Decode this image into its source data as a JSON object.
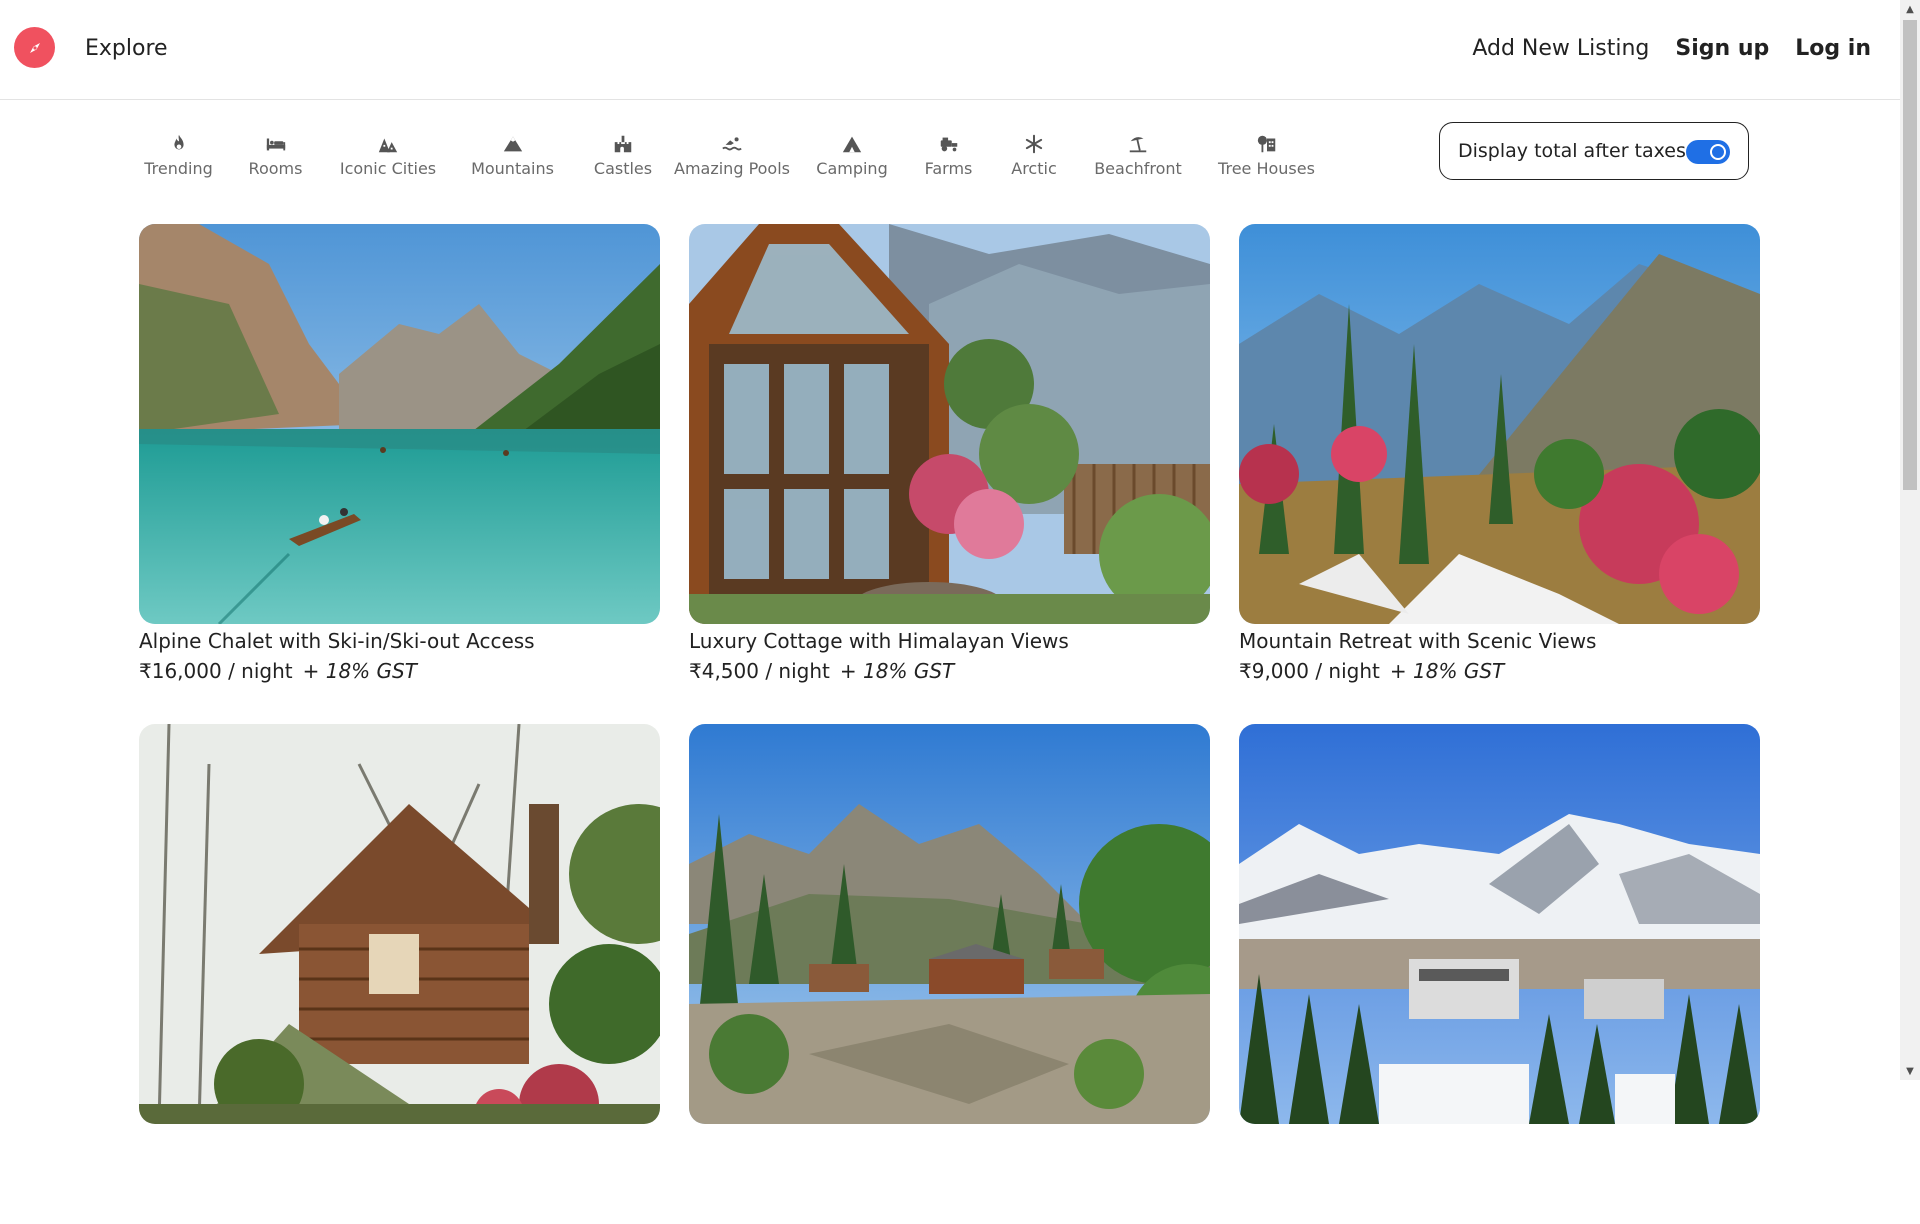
{
  "navbar": {
    "explore": "Explore",
    "add_listing": "Add New Listing",
    "signup": "Sign up",
    "login": "Log in",
    "brand_color": "#f0515f"
  },
  "filters": [
    {
      "label": "Trending",
      "icon": "fire-icon"
    },
    {
      "label": "Rooms",
      "icon": "bed-icon"
    },
    {
      "label": "Iconic Cities",
      "icon": "city-icon"
    },
    {
      "label": "Mountains",
      "icon": "mountain-icon"
    },
    {
      "label": "Castles",
      "icon": "castle-icon"
    },
    {
      "label": "Amazing Pools",
      "icon": "swimmer-icon"
    },
    {
      "label": "Camping",
      "icon": "tent-icon"
    },
    {
      "label": "Farms",
      "icon": "tractor-icon"
    },
    {
      "label": "Arctic",
      "icon": "snowflake-icon"
    },
    {
      "label": "Beachfront",
      "icon": "umbrella-beach-icon"
    },
    {
      "label": "Tree Houses",
      "icon": "tree-house-icon"
    }
  ],
  "tax_toggle": {
    "label": "Display total after taxes",
    "on": true,
    "accent": "#1f6fe5"
  },
  "listings": [
    {
      "title": "Alpine Chalet with Ski-in/Ski-out Access",
      "price": "₹16,000 / night",
      "tax": "+ 18% GST"
    },
    {
      "title": "Luxury Cottage with Himalayan Views",
      "price": "₹4,500 / night",
      "tax": "+ 18% GST"
    },
    {
      "title": "Mountain Retreat with Scenic Views",
      "price": "₹9,000 / night",
      "tax": "+ 18% GST"
    },
    {
      "title": "",
      "price": "",
      "tax": ""
    },
    {
      "title": "",
      "price": "",
      "tax": ""
    },
    {
      "title": "",
      "price": "",
      "tax": ""
    }
  ]
}
